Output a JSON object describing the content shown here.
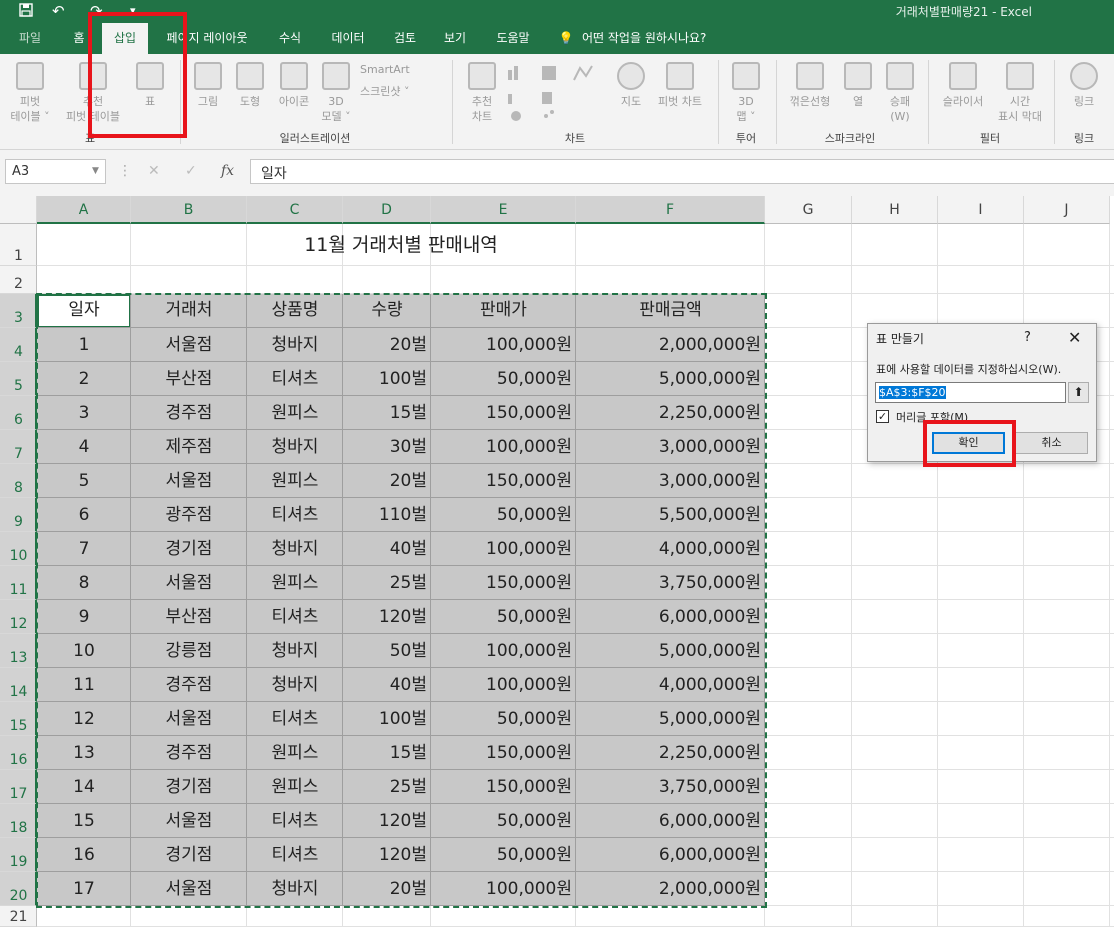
{
  "titlebar": {
    "title": "거래처별판매량21  -  Excel",
    "save_icon": "save-icon",
    "undo_icon": "undo-icon",
    "redo_icon": "redo-icon"
  },
  "tabs": [
    "파일",
    "홈",
    "삽입",
    "페이지 레이아웃",
    "수식",
    "데이터",
    "검토",
    "보기",
    "도움말"
  ],
  "active_tab": "삽입",
  "tell_me": "어떤 작업을 원하시나요?",
  "ribbon": {
    "buttons": {
      "pivot": "피벗\n테이블 ˅",
      "rec_pivot": "추천\n피벗 테이블",
      "table": "표",
      "pictures": "그림",
      "shapes": "도형",
      "icons": "아이콘",
      "model3d": "3D\n모델 ˅",
      "smartart": "SmartArt",
      "screenshot": "스크린샷 ˅",
      "rec_charts": "추천\n차트",
      "maps": "지도",
      "pivot_chart": "피벗 차트",
      "map3d": "3D\n맵 ˅",
      "line": "꺾은선형",
      "column": "열",
      "winloss": "승패\n(W)",
      "slicer": "슬라이서",
      "timeline": "시간\n표시 막대",
      "link": "링크"
    },
    "groups": {
      "tables": "표",
      "illustrations": "일러스트레이션",
      "charts": "차트",
      "tours": "투어",
      "sparklines": "스파크라인",
      "filters": "필터",
      "links": "링크"
    }
  },
  "formula_bar": {
    "name_box": "A3",
    "fx": "fx",
    "content": "일자"
  },
  "columns": [
    "A",
    "B",
    "C",
    "D",
    "E",
    "F",
    "G",
    "H",
    "I",
    "J"
  ],
  "rows": [
    "1",
    "2",
    "3",
    "4",
    "5",
    "6",
    "7",
    "8",
    "9",
    "10",
    "11",
    "12",
    "13",
    "14",
    "15",
    "16",
    "17",
    "18",
    "19",
    "20",
    "21"
  ],
  "sheet": {
    "title": "11월 거래처별 판매내역",
    "headers": [
      "일자",
      "거래처",
      "상품명",
      "수량",
      "판매가",
      "판매금액"
    ],
    "data": [
      [
        "1",
        "서울점",
        "청바지",
        "20벌",
        "100,000원",
        "2,000,000원"
      ],
      [
        "2",
        "부산점",
        "티셔츠",
        "100벌",
        "50,000원",
        "5,000,000원"
      ],
      [
        "3",
        "경주점",
        "원피스",
        "15벌",
        "150,000원",
        "2,250,000원"
      ],
      [
        "4",
        "제주점",
        "청바지",
        "30벌",
        "100,000원",
        "3,000,000원"
      ],
      [
        "5",
        "서울점",
        "원피스",
        "20벌",
        "150,000원",
        "3,000,000원"
      ],
      [
        "6",
        "광주점",
        "티셔츠",
        "110벌",
        "50,000원",
        "5,500,000원"
      ],
      [
        "7",
        "경기점",
        "청바지",
        "40벌",
        "100,000원",
        "4,000,000원"
      ],
      [
        "8",
        "서울점",
        "원피스",
        "25벌",
        "150,000원",
        "3,750,000원"
      ],
      [
        "9",
        "부산점",
        "티셔츠",
        "120벌",
        "50,000원",
        "6,000,000원"
      ],
      [
        "10",
        "강릉점",
        "청바지",
        "50벌",
        "100,000원",
        "5,000,000원"
      ],
      [
        "11",
        "경주점",
        "청바지",
        "40벌",
        "100,000원",
        "4,000,000원"
      ],
      [
        "12",
        "서울점",
        "티셔츠",
        "100벌",
        "50,000원",
        "5,000,000원"
      ],
      [
        "13",
        "경주점",
        "원피스",
        "15벌",
        "150,000원",
        "2,250,000원"
      ],
      [
        "14",
        "경기점",
        "원피스",
        "25벌",
        "150,000원",
        "3,750,000원"
      ],
      [
        "15",
        "서울점",
        "티셔츠",
        "120벌",
        "50,000원",
        "6,000,000원"
      ],
      [
        "16",
        "경기점",
        "티셔츠",
        "120벌",
        "50,000원",
        "6,000,000원"
      ],
      [
        "17",
        "서울점",
        "청바지",
        "20벌",
        "100,000원",
        "2,000,000원"
      ]
    ]
  },
  "dialog": {
    "title": "표 만들기",
    "help": "?",
    "close": "✕",
    "prompt": "표에 사용할 데이터를 지정하십시오(W).",
    "range": "$A$3:$F$20",
    "has_headers_label": "머리글 포함(M)",
    "has_headers_checked": true,
    "ok": "확인",
    "cancel": "취소"
  },
  "colors": {
    "excel_green": "#217346",
    "highlight_red": "#e8141b",
    "selection_gray": "#c8c8c8"
  }
}
